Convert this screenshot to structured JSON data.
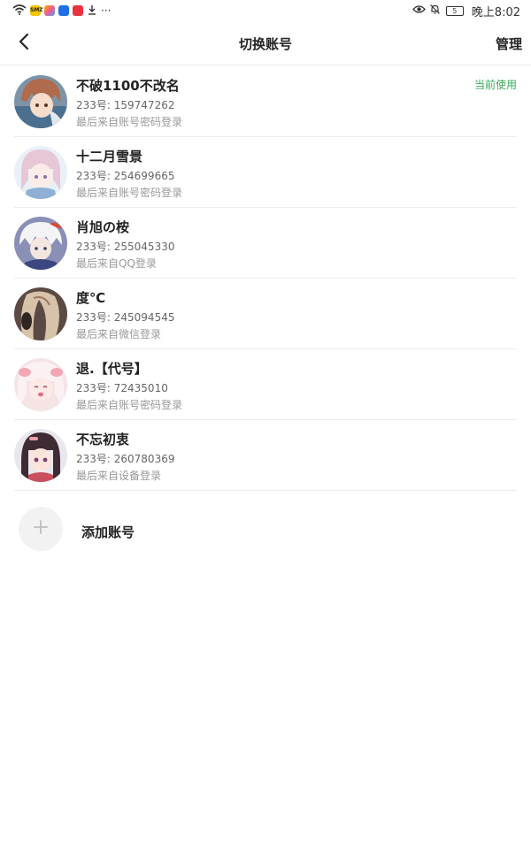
{
  "statusbar": {
    "app_badges": [
      "SMZ",
      "",
      "",
      "",
      ""
    ],
    "more": "···",
    "battery": "5",
    "time": "晚上8:02"
  },
  "header": {
    "title": "切换账号",
    "manage": "管理"
  },
  "accounts": [
    {
      "name": "不破1100不改名",
      "id": "233号: 159747262",
      "login": "最后来自账号密码登录",
      "current": "当前使用"
    },
    {
      "name": "十二月雪景",
      "id": "233号: 254699665",
      "login": "最后来自账号密码登录"
    },
    {
      "name": "肖旭の桉",
      "id": "233号: 255045330",
      "login": "最后来自QQ登录"
    },
    {
      "name": "度℃",
      "id": "233号: 245094545",
      "login": "最后来自微信登录"
    },
    {
      "name": "退.【代号】",
      "id": "233号: 72435010",
      "login": "最后来自账号密码登录"
    },
    {
      "name": "不忘初衷",
      "id": "233号: 260780369",
      "login": "最后来自设备登录"
    }
  ],
  "add_account": {
    "label": "添加账号"
  },
  "colors": {
    "accent_green": "#3aa757",
    "divider": "#ececec",
    "secondary_text": "#666666",
    "tertiary_text": "#999999"
  },
  "icons": [
    "wifi-icon",
    "download-icon",
    "eye-icon",
    "bell-off-icon",
    "battery-icon",
    "back-arrow-icon",
    "plus-icon"
  ]
}
